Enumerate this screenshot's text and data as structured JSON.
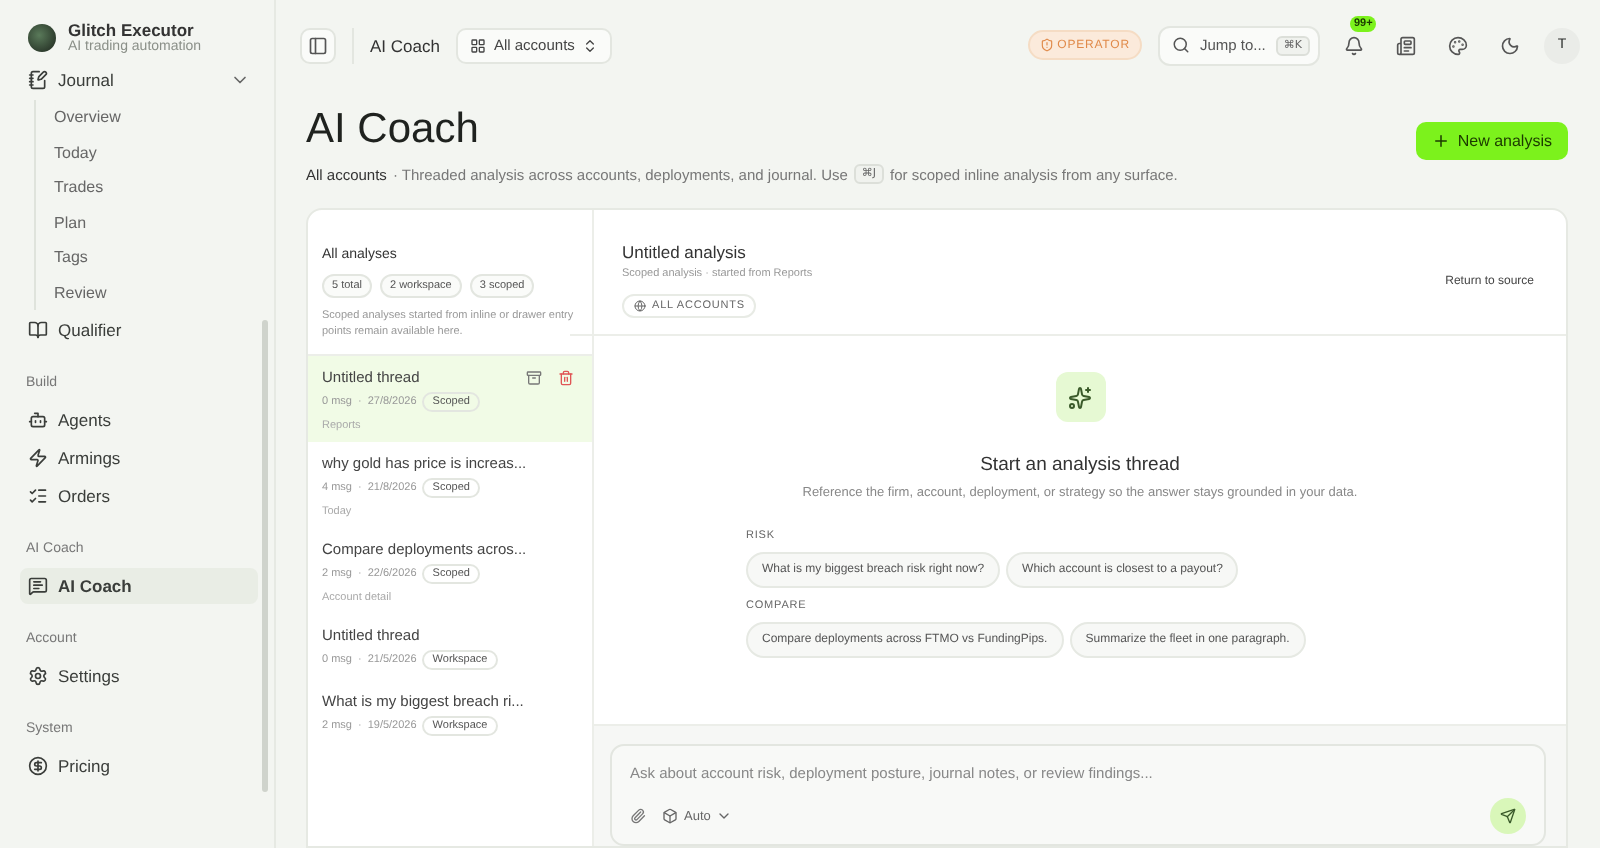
{
  "brand": {
    "name": "Glitch Executor",
    "tagline": "AI trading automation"
  },
  "sidebar": {
    "groups": [
      {
        "items": [
          {
            "label": "Journal",
            "selected": false,
            "expanded": true,
            "children": [
              {
                "label": "Overview",
                "selected": false
              },
              {
                "label": "Today",
                "selected": false
              },
              {
                "label": "Trades",
                "selected": false
              },
              {
                "label": "Plan",
                "selected": false
              },
              {
                "label": "Tags",
                "selected": false
              },
              {
                "label": "Review",
                "selected": false
              }
            ]
          },
          {
            "label": "Qualifier",
            "selected": false
          }
        ]
      },
      {
        "heading": "Build",
        "items": [
          {
            "label": "Agents",
            "selected": false
          },
          {
            "label": "Armings",
            "selected": false
          },
          {
            "label": "Orders",
            "selected": false
          }
        ]
      },
      {
        "heading": "AI Coach",
        "items": [
          {
            "label": "AI Coach",
            "selected": true
          }
        ]
      },
      {
        "heading": "Account",
        "items": [
          {
            "label": "Settings",
            "selected": false
          }
        ]
      },
      {
        "heading": "System",
        "items": [
          {
            "label": "Pricing",
            "selected": false
          }
        ]
      }
    ]
  },
  "topbar": {
    "breadcrumb": "AI Coach",
    "account_select": "All accounts",
    "role_badge": "OPERATOR",
    "search": {
      "placeholder": "Jump to...",
      "shortcut": "⌘K"
    },
    "notification_count": "99+",
    "avatar": "T"
  },
  "page": {
    "title": "AI Coach",
    "scope": "All accounts",
    "description_before": "· Threaded analysis across accounts, deployments, and journal. Use",
    "shortcut": "⌘J",
    "description_after": "for scoped inline analysis from any surface.",
    "primary_action": "New analysis"
  },
  "threads": {
    "heading": "All analyses",
    "meta_separator": "·",
    "counts": [
      "5 total",
      "2 workspace",
      "3 scoped"
    ],
    "note": "Scoped analyses started from inline or drawer entry points remain available here.",
    "items": [
      {
        "title": "Untitled thread",
        "messages": "0 msg",
        "date": "27/8/2026",
        "tag": "Scoped",
        "source": "Reports",
        "selected": true
      },
      {
        "title": "why gold has price is increas...",
        "messages": "4 msg",
        "date": "21/8/2026",
        "tag": "Scoped",
        "source": "Today",
        "selected": false
      },
      {
        "title": "Compare deployments acros...",
        "messages": "2 msg",
        "date": "22/6/2026",
        "tag": "Scoped",
        "source": "Account detail",
        "selected": false
      },
      {
        "title": "Untitled thread",
        "messages": "0 msg",
        "date": "21/5/2026",
        "tag": "Workspace",
        "selected": false
      },
      {
        "title": "What is my biggest breach ri...",
        "messages": "2 msg",
        "date": "19/5/2026",
        "tag": "Workspace",
        "selected": false
      }
    ]
  },
  "conversation": {
    "title": "Untitled analysis",
    "subtitle": "Scoped analysis · started from Reports",
    "scope_chip": "ALL ACCOUNTS",
    "return_link": "Return to source",
    "empty_title": "Start an analysis thread",
    "empty_text": "Reference the firm, account, deployment, or strategy so the answer stays grounded in your data.",
    "suggestion_groups": [
      {
        "label": "RISK",
        "prompts": [
          "What is my biggest breach risk right now?",
          "Which account is closest to a payout?"
        ]
      },
      {
        "label": "COMPARE",
        "prompts": [
          "Compare deployments across FTMO vs FundingPips.",
          "Summarize the fleet in one paragraph."
        ]
      }
    ],
    "composer": {
      "placeholder": "Ask about account risk, deployment posture, journal notes, or review findings...",
      "model": "Auto"
    }
  }
}
